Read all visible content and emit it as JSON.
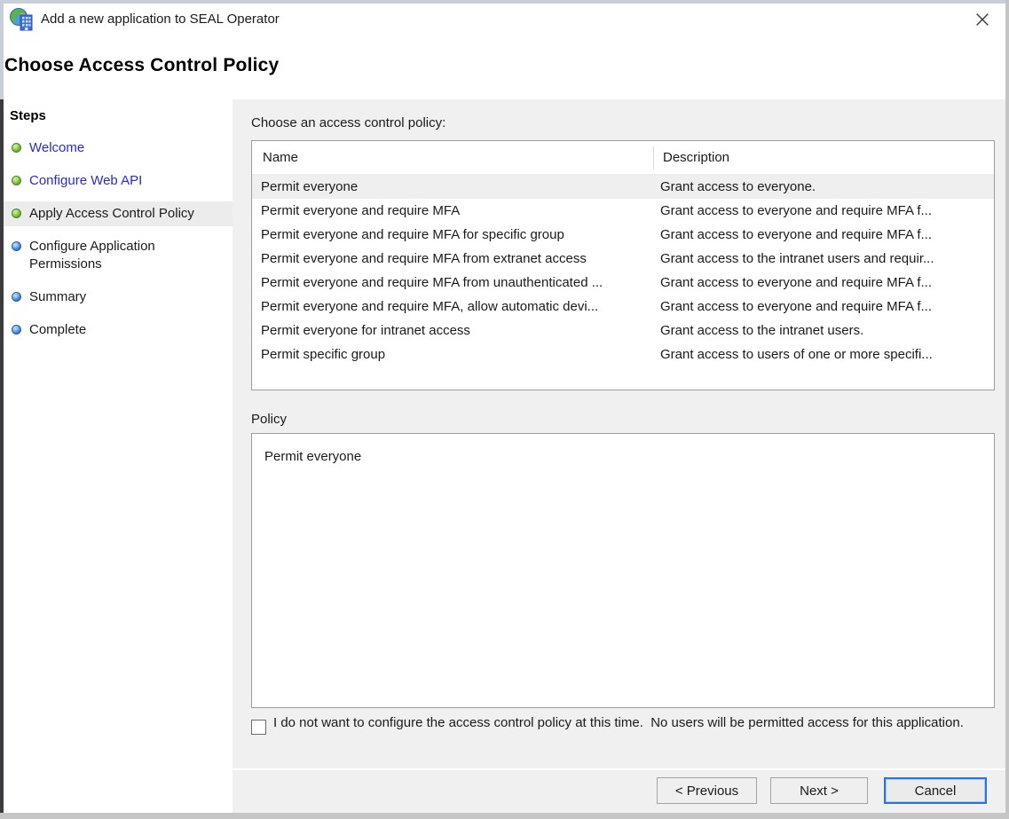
{
  "window": {
    "title": "Add a new application to SEAL Operator"
  },
  "page": {
    "heading": "Choose Access Control Policy"
  },
  "sidebar": {
    "title": "Steps",
    "items": [
      {
        "label": "Welcome",
        "state": "done"
      },
      {
        "label": "Configure Web API",
        "state": "done"
      },
      {
        "label": "Apply Access Control Policy",
        "state": "current"
      },
      {
        "label": "Configure Application Permissions",
        "state": "upcoming"
      },
      {
        "label": "Summary",
        "state": "upcoming"
      },
      {
        "label": "Complete",
        "state": "upcoming"
      }
    ]
  },
  "main": {
    "instruction": "Choose an access control policy:",
    "table": {
      "columns": [
        "Name",
        "Description"
      ],
      "rows": [
        {
          "name": "Permit everyone",
          "description": "Grant access to everyone.",
          "selected": true
        },
        {
          "name": "Permit everyone and require MFA",
          "description": "Grant access to everyone and require MFA f...",
          "selected": false
        },
        {
          "name": "Permit everyone and require MFA for specific group",
          "description": "Grant access to everyone and require MFA f...",
          "selected": false
        },
        {
          "name": "Permit everyone and require MFA from extranet access",
          "description": "Grant access to the intranet users and requir...",
          "selected": false
        },
        {
          "name": "Permit everyone and require MFA from unauthenticated ...",
          "description": "Grant access to everyone and require MFA f...",
          "selected": false
        },
        {
          "name": "Permit everyone and require MFA, allow automatic devi...",
          "description": "Grant access to everyone and require MFA f...",
          "selected": false
        },
        {
          "name": "Permit everyone for intranet access",
          "description": "Grant access to the intranet users.",
          "selected": false
        },
        {
          "name": "Permit specific group",
          "description": "Grant access to users of one or more specifi...",
          "selected": false
        }
      ]
    },
    "policy_label": "Policy",
    "policy_text": "Permit everyone",
    "checkbox": {
      "checked": false,
      "label": "I do not want to configure the access control policy at this time.  No users will be permitted access for this application."
    }
  },
  "footer": {
    "previous_label": "< Previous",
    "next_label": "Next >",
    "cancel_label": "Cancel"
  },
  "colors": {
    "link_blue": "#2a2ad4",
    "step_done_green": "#5ea81c",
    "step_upcoming_blue": "#2e6fc8",
    "focus_blue": "#2d74d3",
    "selection_bg": "#efefef",
    "main_bg": "#f0f0f0"
  }
}
